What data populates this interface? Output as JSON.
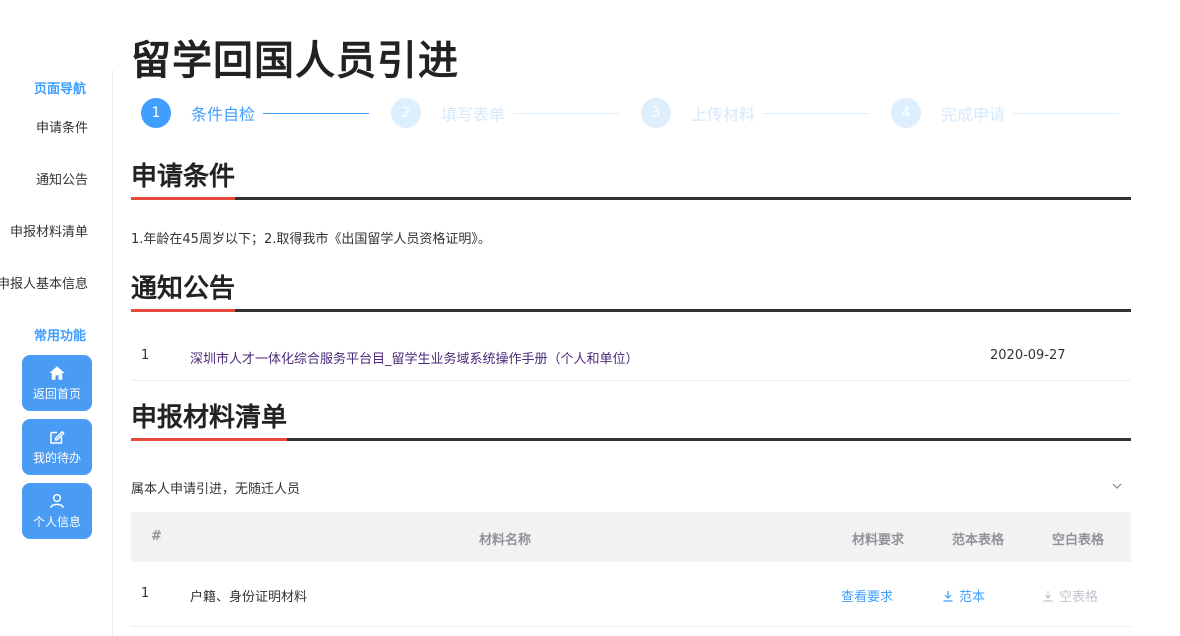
{
  "page_title": "留学回国人员引进",
  "sidebar": {
    "nav_heading": "页面导航",
    "nav_items": [
      {
        "label": "申请条件"
      },
      {
        "label": "通知公告"
      },
      {
        "label": "申报材料清单"
      },
      {
        "label": "申报人基本信息"
      }
    ],
    "func_heading": "常用功能",
    "quick_buttons": [
      {
        "label": "返回首页",
        "icon": "home-icon"
      },
      {
        "label": "我的待办",
        "icon": "edit-icon"
      },
      {
        "label": "个人信息",
        "icon": "user-icon"
      }
    ]
  },
  "steps": [
    {
      "num": "1",
      "label": "条件自检",
      "state": "active"
    },
    {
      "num": "2",
      "label": "填写表单",
      "state": "pending"
    },
    {
      "num": "3",
      "label": "上传材料",
      "state": "pending"
    },
    {
      "num": "4",
      "label": "完成申请",
      "state": "pending"
    }
  ],
  "sections": {
    "conditions": {
      "title": "申请条件",
      "text": "1.年龄在45周岁以下；2.取得我市《出国留学人员资格证明》。"
    },
    "notices": {
      "title": "通知公告",
      "items": [
        {
          "index": "1",
          "title": "深圳市人才一体化综合服务平台目_留学生业务域系统操作手册（个人和单位）",
          "date": "2020-09-27"
        }
      ]
    },
    "materials": {
      "title": "申报材料清单",
      "applicant_type": "属本人申请引进，无随迁人员",
      "columns": {
        "index": "#",
        "name": "材料名称",
        "requirement": "材料要求",
        "template": "范本表格",
        "blank": "空白表格"
      },
      "rows": [
        {
          "index": "1",
          "name": "户籍、身份证明材料",
          "requirement": "查看要求",
          "template": "范本",
          "blank": "空表格"
        }
      ]
    }
  },
  "colors": {
    "accent": "#409eff",
    "rule_accent": "#e64a3c",
    "link_visited": "#4b2a7a",
    "button_bg": "#4a9bf3"
  }
}
